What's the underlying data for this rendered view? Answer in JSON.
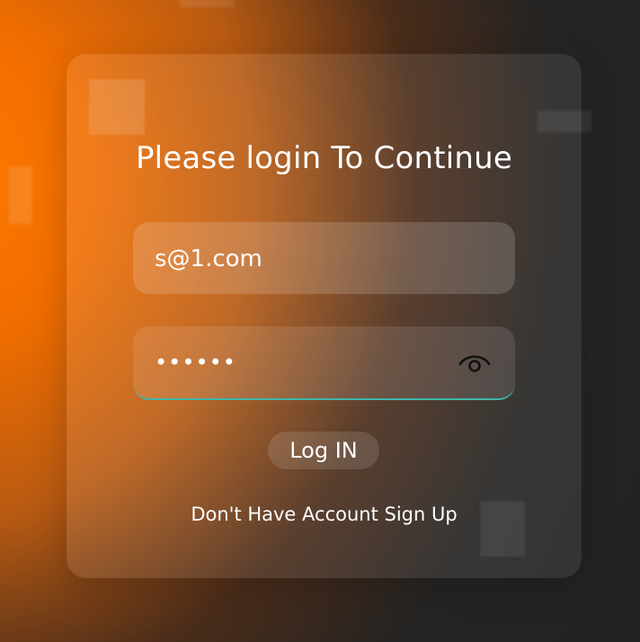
{
  "login": {
    "title": "Please login To Continue",
    "email_value": "s@1.com",
    "password_masked": "••••••",
    "login_button": "Log IN",
    "signup_link": "Don't Have Account Sign Up"
  },
  "icons": {
    "password_toggle": "eye-icon"
  },
  "colors": {
    "accent_orange": "#ff7a00",
    "background_dark": "#232323",
    "focus_underline": "#3fb6a8",
    "text": "#ffffff"
  }
}
